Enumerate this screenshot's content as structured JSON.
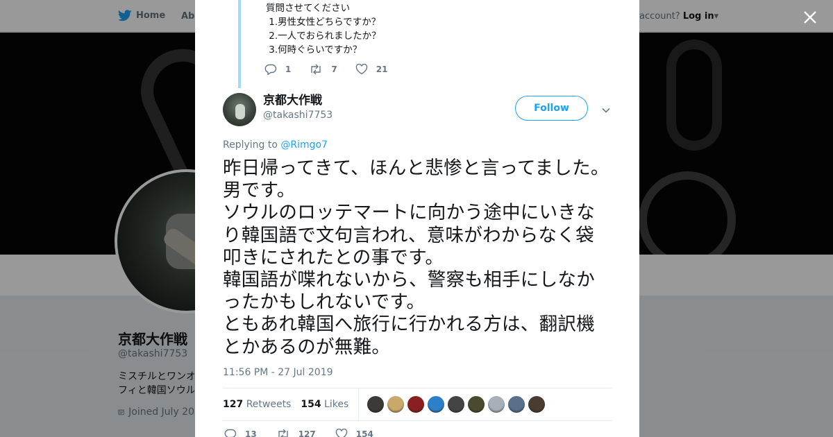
{
  "nav": {
    "home_label": "Home",
    "about_label": "Abo",
    "account_prompt": "account?",
    "login_label": "Log in"
  },
  "profile": {
    "name": "京都大作戦",
    "handle": "@takashi7753",
    "bio_line1": "ミスチルとワンオ",
    "bio_line2": "フィと韓国ソウル",
    "joined": "Joined July 20"
  },
  "previous_tweet": {
    "text": "質問させてください\n 1.男性女性どちらですか？\n 2.一人でおられましたか？\n 3.何時ぐらいですか？",
    "replies": "1",
    "retweets": "7",
    "likes": "21"
  },
  "tweet": {
    "author_name": "京都大作戦",
    "author_handle": "@takashi7753",
    "follow_label": "Follow",
    "replying_prefix": "Replying to",
    "replying_to": "@Rimgo7",
    "text": "昨日帰ってきて、ほんと悲惨と言ってました。男です。\nソウルのロッテマートに向かう途中にいきなり韓国語で文句言われ、意味がわからなく袋叩きにされたとの事です。\n韓国語が喋れないから、警察も相手にしなかったかもしれないです。\nともあれ韓国へ旅行に行かれる方は、翻訳機とかあるのが無難。",
    "timestamp": "11:56 PM - 27 Jul 2019",
    "retweet_count": "127",
    "retweet_label": "Retweets",
    "like_count": "154",
    "like_label": "Likes",
    "replies": "13",
    "retweets": "127",
    "likes": "154"
  },
  "liker_colors": [
    "#3b3a36",
    "#c9a86a",
    "#8a1f1f",
    "#2c7fc9",
    "#444444",
    "#4a4a2e",
    "#a7b0b8",
    "#5a6f8a",
    "#4b3c32"
  ],
  "colors": {
    "accent": "#1da1f2",
    "thread_line": "#a4d9f9",
    "muted": "#657786"
  }
}
